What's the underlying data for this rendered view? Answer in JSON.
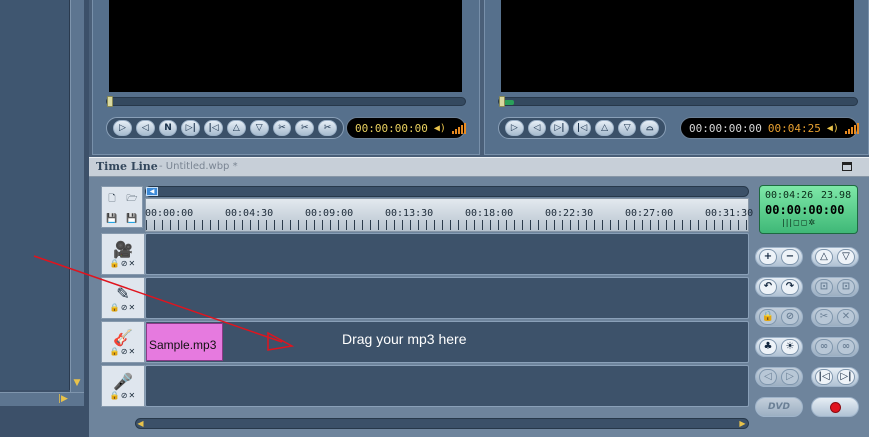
{
  "left_monitor": {
    "controls": [
      "▷",
      "◁",
      "N",
      "▷|",
      "|◁",
      "△",
      "▽",
      "✂",
      "✂",
      "✂"
    ],
    "time": "00:00:00:00",
    "speaker_icon": "speaker-icon"
  },
  "right_monitor": {
    "controls": [
      "▷",
      "◁",
      "▷|",
      "|◁",
      "△",
      "▽",
      "⌓"
    ],
    "time": "00:00:00:00",
    "duration": "00:04:25",
    "speaker_icon": "speaker-icon"
  },
  "timeline": {
    "title": "Time Line",
    "file": "- Untitled.wbp *",
    "ruler_labels": [
      "00:00:00",
      "00:04:30",
      "00:09:00",
      "00:13:30",
      "00:18:00",
      "00:22:30",
      "00:27:00",
      "00:31:30"
    ],
    "tracks": [
      {
        "icon": "video-camera-icon",
        "glyph": "🎥"
      },
      {
        "icon": "edit-pencil-icon",
        "glyph": "✎"
      },
      {
        "icon": "guitar-icon",
        "glyph": "🎸"
      },
      {
        "icon": "microphone-icon",
        "glyph": "🎤"
      }
    ],
    "track_locks": "🔒⊘✕",
    "clip_label": "Sample.mp3",
    "drop_hint": "Drag your mp3 here"
  },
  "timecode": {
    "duration": "00:04:26",
    "fps": "23.98",
    "current": "00:00:00:00",
    "strip": "|||◻◻✲"
  },
  "right_controls": [
    {
      "left": "+",
      "right": "−",
      "dim": false
    },
    {
      "left": "△",
      "right": "▽",
      "dim": false
    },
    {
      "left": "↶",
      "right": "↷",
      "dim": false
    },
    {
      "left": "⊡",
      "right": "⊡",
      "dim": true
    },
    {
      "left": "🔒",
      "right": "⊘",
      "dim": true
    },
    {
      "left": "✂",
      "right": "✕",
      "dim": true
    },
    {
      "left": "♣",
      "right": "☀",
      "dim": false
    },
    {
      "left": "∞",
      "right": "∞",
      "dim": true
    },
    {
      "left": "◁",
      "right": "▷",
      "dim": true
    },
    {
      "left": "|◁",
      "right": "▷|",
      "dim": false
    },
    {
      "left": "DVD",
      "right": "",
      "dim": true
    }
  ],
  "colors": {
    "accent": "#e8c24a",
    "clip": "#e67adf",
    "record": "#e0141e",
    "timecode_bg": "#4fc987"
  }
}
